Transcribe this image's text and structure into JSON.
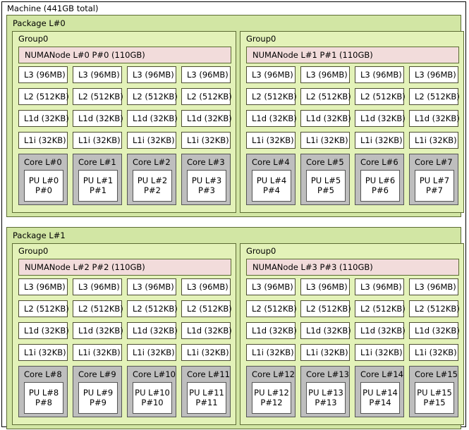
{
  "machine": {
    "title": "Machine (441GB total)"
  },
  "colors": {
    "machine_bg": "#ffffff",
    "machine_border": "#000000",
    "package_bg": "#d2e6a4",
    "package_border": "#5c6b33",
    "group_bg": "#e3f2b8",
    "group_border": "#5c6b33",
    "numanode_bg": "#f2dcdb",
    "numanode_border": "#5c6b33",
    "cache_bg": "#ffffff",
    "cache_border": "#4d4d33",
    "core_bg": "#bebebe",
    "core_border": "#555555",
    "pu_bg": "#ffffff",
    "pu_border": "#555555"
  },
  "packages": [
    {
      "label": "Package L#0",
      "groups": [
        {
          "label": "Group0",
          "numanode": "NUMANode L#0 P#0 (110GB)",
          "caches": [
            [
              "L3 (96MB)",
              "L3 (96MB)",
              "L3 (96MB)",
              "L3 (96MB)"
            ],
            [
              "L2 (512KB)",
              "L2 (512KB)",
              "L2 (512KB)",
              "L2 (512KB)"
            ],
            [
              "L1d (32KB)",
              "L1d (32KB)",
              "L1d (32KB)",
              "L1d (32KB)"
            ],
            [
              "L1i (32KB)",
              "L1i (32KB)",
              "L1i (32KB)",
              "L1i (32KB)"
            ]
          ],
          "cores": [
            {
              "label": "Core L#0",
              "pu_l": "PU L#0",
              "pu_p": "P#0"
            },
            {
              "label": "Core L#1",
              "pu_l": "PU L#1",
              "pu_p": "P#1"
            },
            {
              "label": "Core L#2",
              "pu_l": "PU L#2",
              "pu_p": "P#2"
            },
            {
              "label": "Core L#3",
              "pu_l": "PU L#3",
              "pu_p": "P#3"
            }
          ]
        },
        {
          "label": "Group0",
          "numanode": "NUMANode L#1 P#1 (110GB)",
          "caches": [
            [
              "L3 (96MB)",
              "L3 (96MB)",
              "L3 (96MB)",
              "L3 (96MB)"
            ],
            [
              "L2 (512KB)",
              "L2 (512KB)",
              "L2 (512KB)",
              "L2 (512KB)"
            ],
            [
              "L1d (32KB)",
              "L1d (32KB)",
              "L1d (32KB)",
              "L1d (32KB)"
            ],
            [
              "L1i (32KB)",
              "L1i (32KB)",
              "L1i (32KB)",
              "L1i (32KB)"
            ]
          ],
          "cores": [
            {
              "label": "Core L#4",
              "pu_l": "PU L#4",
              "pu_p": "P#4"
            },
            {
              "label": "Core L#5",
              "pu_l": "PU L#5",
              "pu_p": "P#5"
            },
            {
              "label": "Core L#6",
              "pu_l": "PU L#6",
              "pu_p": "P#6"
            },
            {
              "label": "Core L#7",
              "pu_l": "PU L#7",
              "pu_p": "P#7"
            }
          ]
        }
      ]
    },
    {
      "label": "Package L#1",
      "groups": [
        {
          "label": "Group0",
          "numanode": "NUMANode L#2 P#2 (110GB)",
          "caches": [
            [
              "L3 (96MB)",
              "L3 (96MB)",
              "L3 (96MB)",
              "L3 (96MB)"
            ],
            [
              "L2 (512KB)",
              "L2 (512KB)",
              "L2 (512KB)",
              "L2 (512KB)"
            ],
            [
              "L1d (32KB)",
              "L1d (32KB)",
              "L1d (32KB)",
              "L1d (32KB)"
            ],
            [
              "L1i (32KB)",
              "L1i (32KB)",
              "L1i (32KB)",
              "L1i (32KB)"
            ]
          ],
          "cores": [
            {
              "label": "Core L#8",
              "pu_l": "PU L#8",
              "pu_p": "P#8"
            },
            {
              "label": "Core L#9",
              "pu_l": "PU L#9",
              "pu_p": "P#9"
            },
            {
              "label": "Core L#10",
              "pu_l": "PU L#10",
              "pu_p": "P#10"
            },
            {
              "label": "Core L#11",
              "pu_l": "PU L#11",
              "pu_p": "P#11"
            }
          ]
        },
        {
          "label": "Group0",
          "numanode": "NUMANode L#3 P#3 (110GB)",
          "caches": [
            [
              "L3 (96MB)",
              "L3 (96MB)",
              "L3 (96MB)",
              "L3 (96MB)"
            ],
            [
              "L2 (512KB)",
              "L2 (512KB)",
              "L2 (512KB)",
              "L2 (512KB)"
            ],
            [
              "L1d (32KB)",
              "L1d (32KB)",
              "L1d (32KB)",
              "L1d (32KB)"
            ],
            [
              "L1i (32KB)",
              "L1i (32KB)",
              "L1i (32KB)",
              "L1i (32KB)"
            ]
          ],
          "cores": [
            {
              "label": "Core L#12",
              "pu_l": "PU L#12",
              "pu_p": "P#12"
            },
            {
              "label": "Core L#13",
              "pu_l": "PU L#13",
              "pu_p": "P#13"
            },
            {
              "label": "Core L#14",
              "pu_l": "PU L#14",
              "pu_p": "P#14"
            },
            {
              "label": "Core L#15",
              "pu_l": "PU L#15",
              "pu_p": "P#15"
            }
          ]
        }
      ]
    }
  ]
}
